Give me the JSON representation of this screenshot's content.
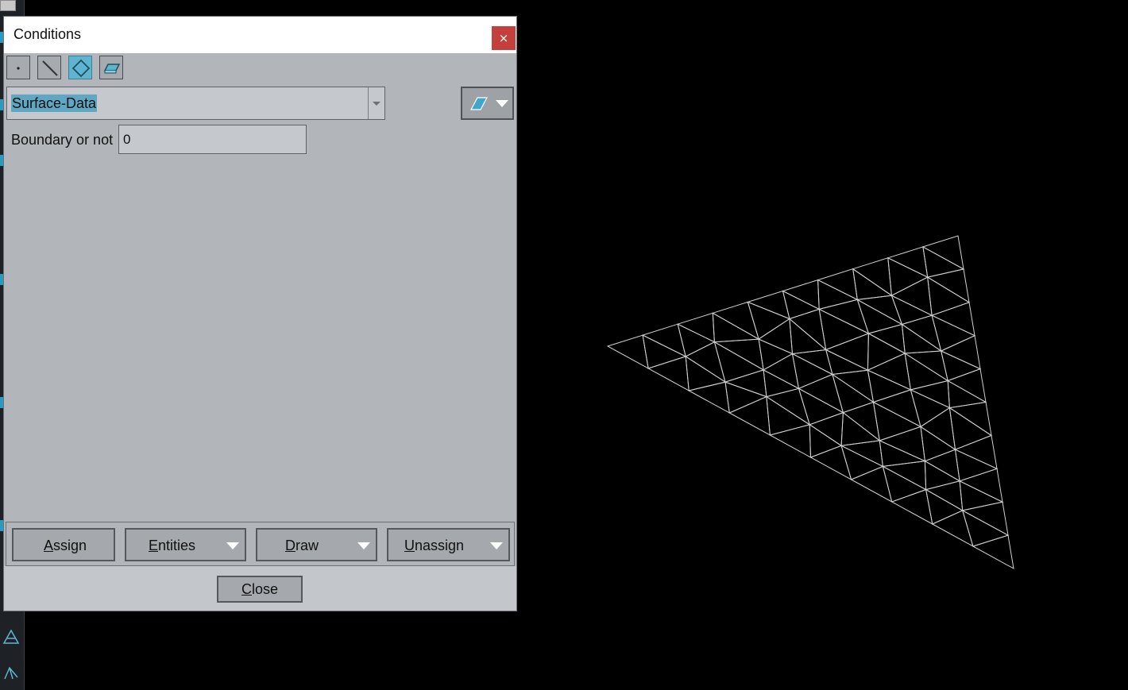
{
  "dialog": {
    "title": "Conditions",
    "close_glyph": "×",
    "entity_types": [
      {
        "name": "point",
        "icon": "point-icon"
      },
      {
        "name": "line",
        "icon": "line-icon"
      },
      {
        "name": "surface",
        "icon": "surface-icon",
        "active": true
      },
      {
        "name": "volume",
        "icon": "volume-icon"
      }
    ],
    "condition_select": {
      "value": "Surface-Data"
    },
    "fields": [
      {
        "label": "Boundary or not",
        "value": "0"
      }
    ],
    "buttons": {
      "assign": {
        "first": "A",
        "rest": "ssign"
      },
      "entities": {
        "first": "E",
        "rest": "ntities"
      },
      "draw": {
        "first": "D",
        "rest": "raw"
      },
      "unassign": {
        "first": "U",
        "rest": "nassign"
      },
      "close": {
        "first": "C",
        "rest": "lose"
      }
    }
  },
  "colors": {
    "accent": "#5fb4cf",
    "close_red": "#c4403d",
    "mesh_stroke": "#d0d0d0",
    "dialog_bg": "#b2b5b9"
  },
  "viewport": {
    "content": "triangular surface mesh wireframe"
  }
}
